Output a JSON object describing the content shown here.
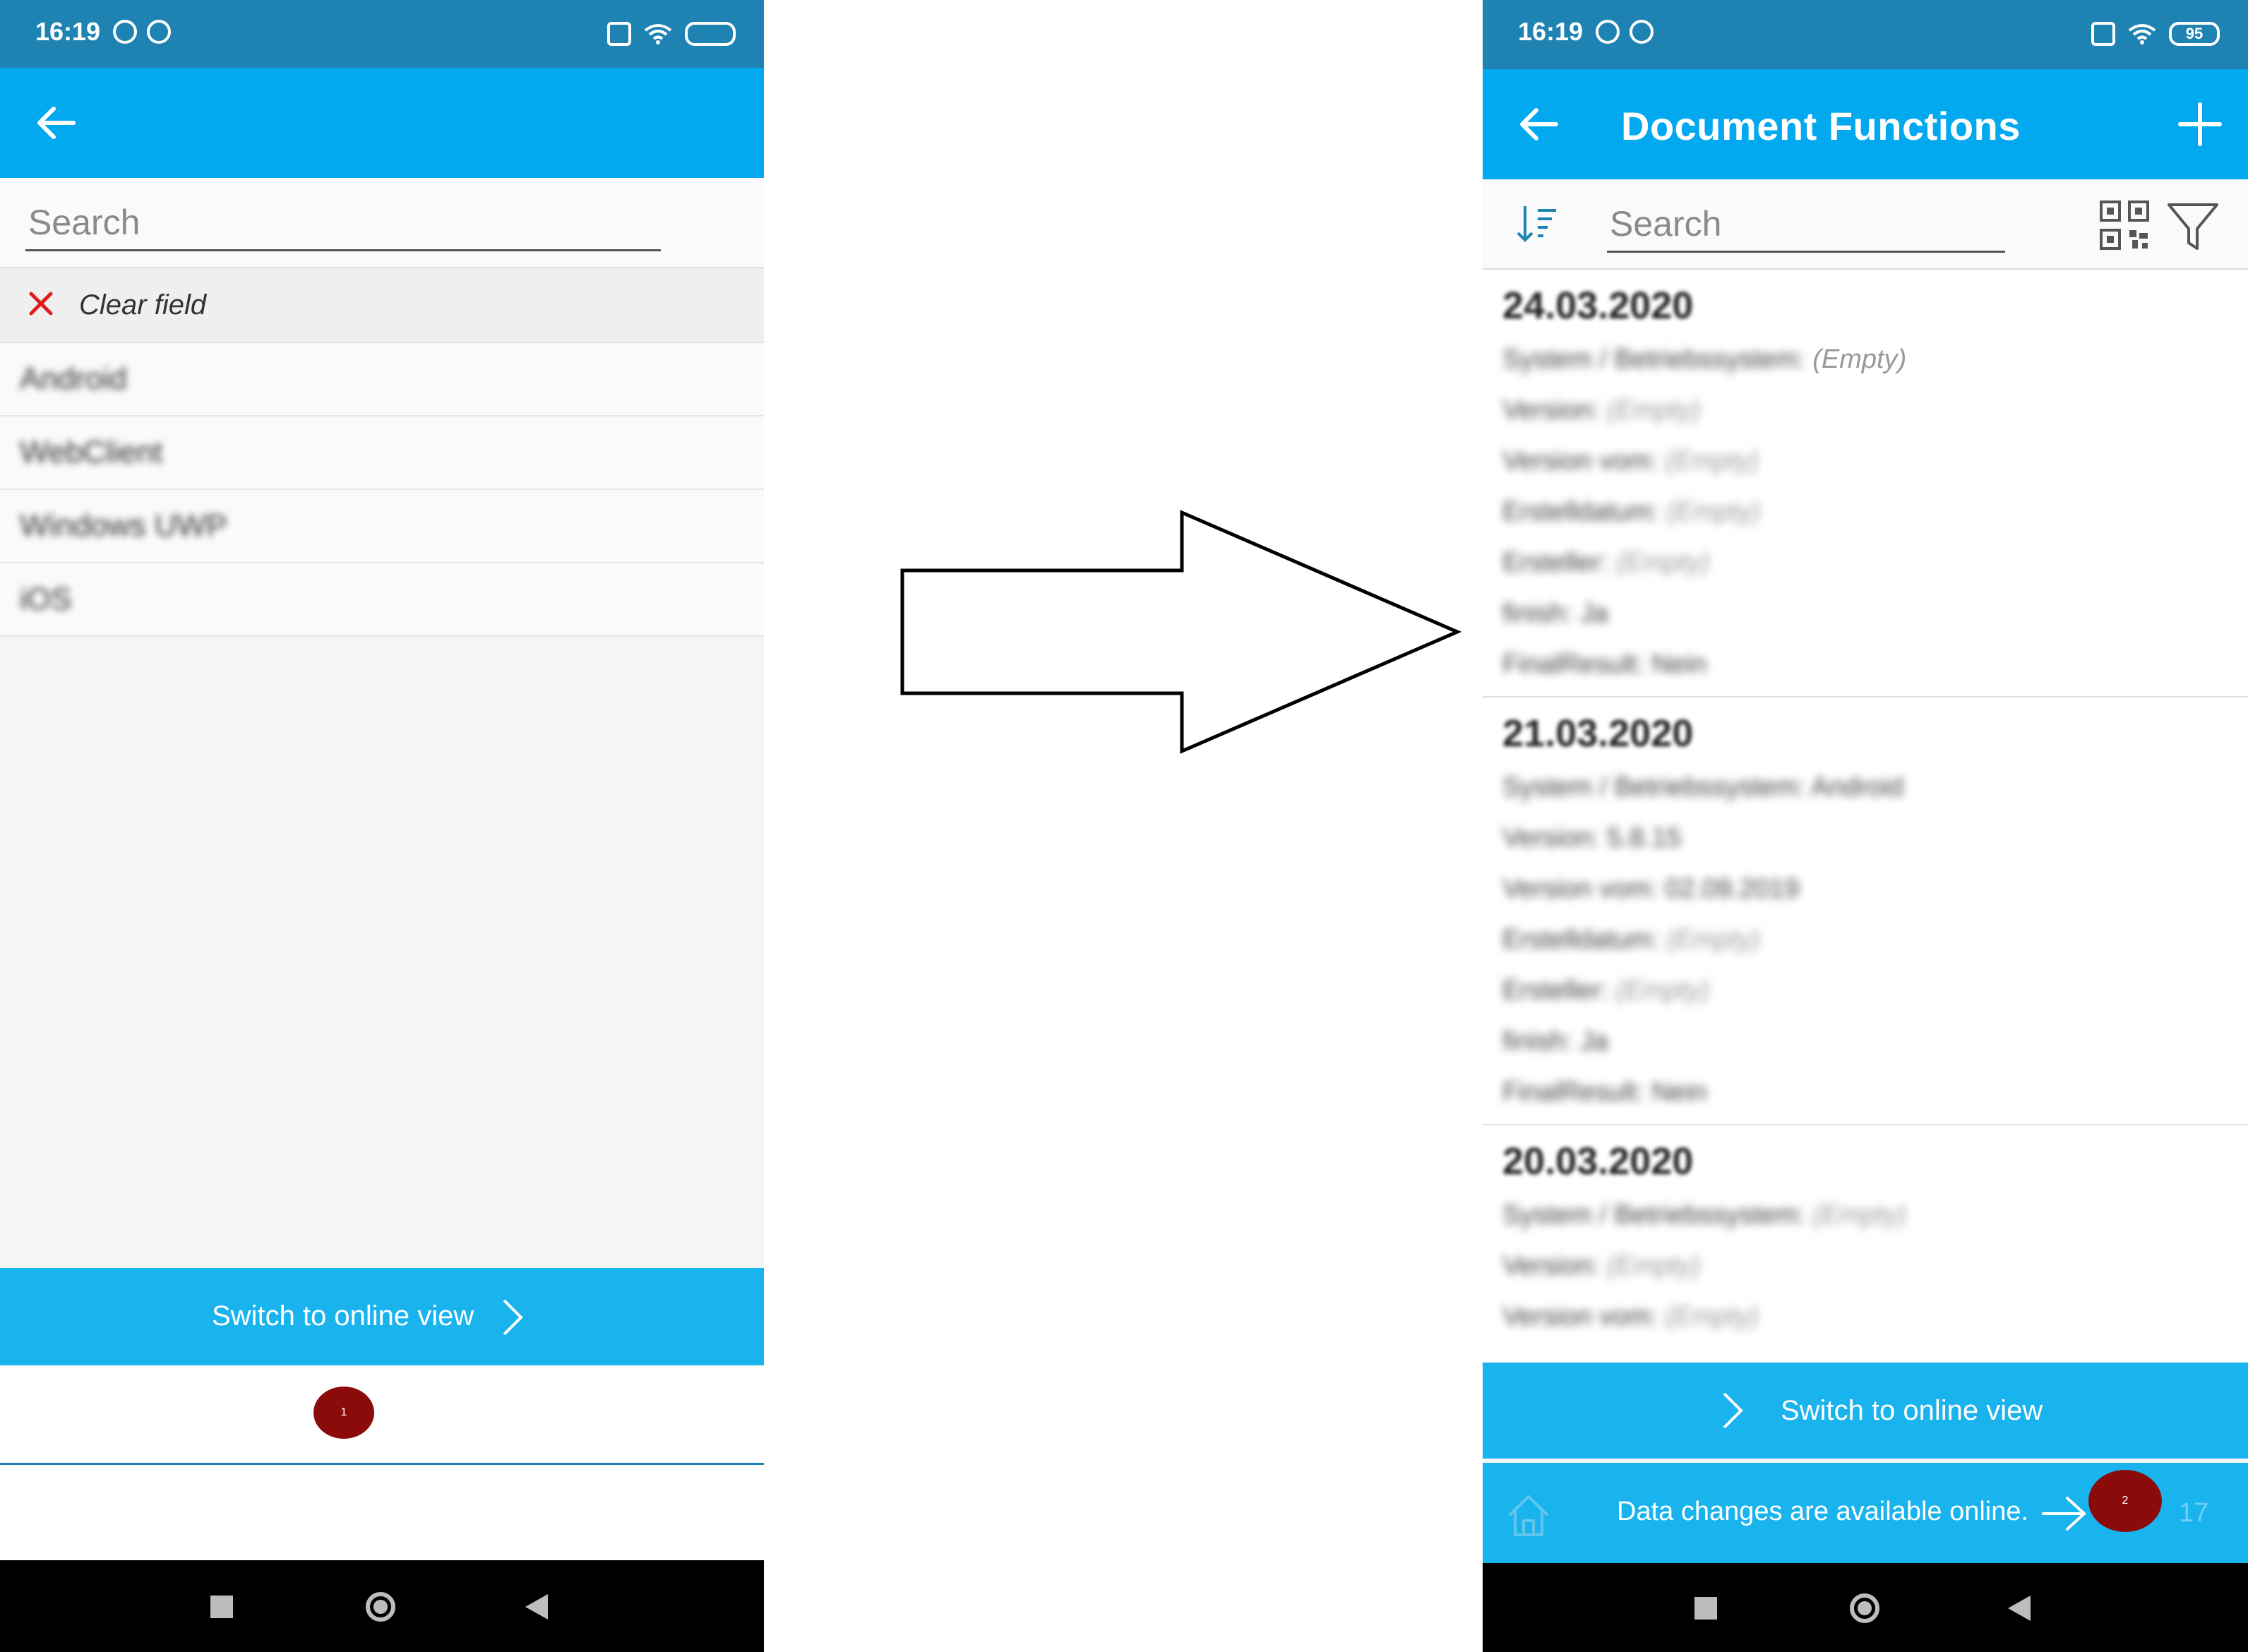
{
  "left_phone": {
    "statusbar": {
      "time": "16:19"
    },
    "search": {
      "placeholder": "Search"
    },
    "clear_field_label": "Clear field",
    "items": [
      "Android",
      "WebClient",
      "Windows UWP",
      "iOS"
    ],
    "switch_online_label": "Switch to online view",
    "badge": "1"
  },
  "right_phone": {
    "statusbar": {
      "time": "16:19",
      "battery": "95"
    },
    "title": "Document Functions",
    "search": {
      "placeholder": "Search"
    },
    "cards": [
      {
        "date": "24.03.2020",
        "fields": [
          {
            "key": "System / Betriebssystem:",
            "value": "(Empty)",
            "value_blurred": false
          },
          {
            "key": "Version:",
            "value": "(Empty)",
            "value_blurred": true
          },
          {
            "key": "Version vom:",
            "value": "(Empty)",
            "value_blurred": true
          },
          {
            "key": "Erstelldatum:",
            "value": "(Empty)",
            "value_blurred": true
          },
          {
            "key": "Ersteller:",
            "value": "(Empty)",
            "value_blurred": true
          },
          {
            "key": "finish:",
            "value": "Ja",
            "value_blurred": true
          },
          {
            "key": "FinalResult:",
            "value": "Nein",
            "value_blurred": true
          }
        ]
      },
      {
        "date": "21.03.2020",
        "fields": [
          {
            "key": "System / Betriebssystem:",
            "value": "Android",
            "value_blurred": true
          },
          {
            "key": "Version:",
            "value": "5.8.15",
            "value_blurred": true
          },
          {
            "key": "Version vom:",
            "value": "02.09.2019",
            "value_blurred": true
          },
          {
            "key": "Erstelldatum:",
            "value": "(Empty)",
            "value_blurred": true
          },
          {
            "key": "Ersteller:",
            "value": "(Empty)",
            "value_blurred": true
          },
          {
            "key": "finish:",
            "value": "Ja",
            "value_blurred": true
          },
          {
            "key": "FinalResult:",
            "value": "Nein",
            "value_blurred": true
          }
        ]
      },
      {
        "date": "20.03.2020",
        "fields": [
          {
            "key": "System / Betriebssystem:",
            "value": "(Empty)",
            "value_blurred": true
          },
          {
            "key": "Version:",
            "value": "(Empty)",
            "value_blurred": true
          },
          {
            "key": "Version vom:",
            "value": "(Empty)",
            "value_blurred": true
          }
        ]
      }
    ],
    "switch_online_label": "Switch to online view",
    "data_changes_label": "Data changes are available online.",
    "page_number": "17",
    "badge": "2"
  },
  "colors": {
    "statusbar": "#1e83b3",
    "toolbar": "#03a9ef",
    "online_button": "#19b3ee",
    "badge": "#8b0b0b"
  }
}
